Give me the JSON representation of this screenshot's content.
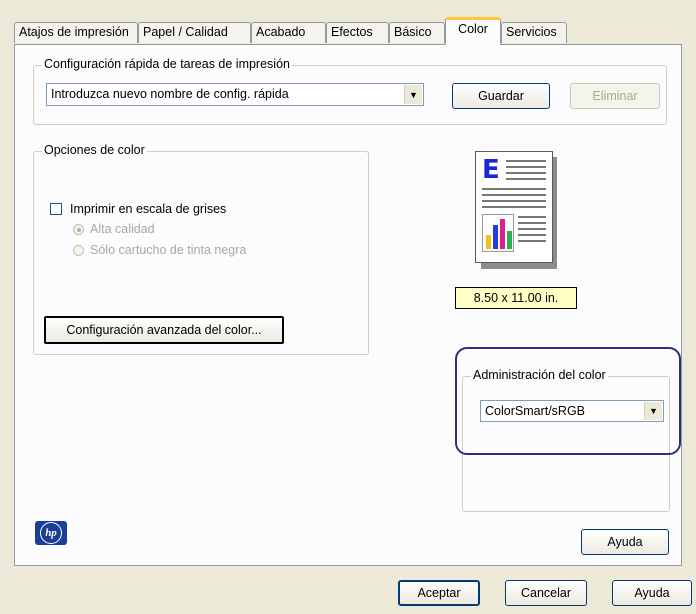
{
  "tabs": [
    {
      "label": "Atajos de impresión"
    },
    {
      "label": "Papel / Calidad"
    },
    {
      "label": "Acabado"
    },
    {
      "label": "Efectos"
    },
    {
      "label": "Básico"
    },
    {
      "label": "Color"
    },
    {
      "label": "Servicios"
    }
  ],
  "quick_setup": {
    "legend": "Configuración rápida de tareas de impresión",
    "combo_value": "Introduzca nuevo nombre de config. rápida",
    "save_label": "Guardar",
    "delete_label": "Eliminar"
  },
  "color_options": {
    "legend": "Opciones de color",
    "grayscale_label": "Imprimir en escala de grises",
    "high_quality_label": "Alta calidad",
    "black_only_label": "Sólo cartucho de tinta negra",
    "advanced_label": "Configuración avanzada del color..."
  },
  "preview": {
    "page_size": "8.50 x 11.00 in."
  },
  "color_management": {
    "legend": "Administración del color",
    "value": "ColorSmart/sRGB"
  },
  "buttons": {
    "help_inner": "Ayuda",
    "ok": "Aceptar",
    "cancel": "Cancelar",
    "help": "Ayuda"
  },
  "colors": {
    "highlight_outline": "#2e2f7a",
    "size_label_bg": "#ffffc6",
    "tab_accent": "#ffc83c"
  }
}
